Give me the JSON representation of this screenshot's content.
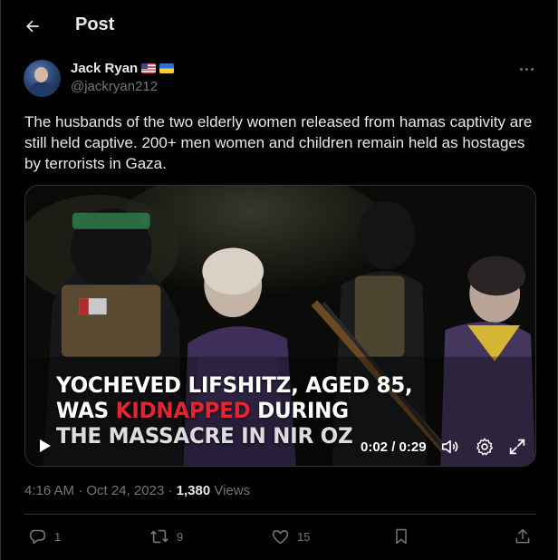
{
  "header": {
    "title": "Post",
    "back_icon": "arrow-left-icon"
  },
  "author": {
    "name": "Jack Ryan",
    "handle": "@jackryan212",
    "badges": [
      "us-flag-icon",
      "ukraine-flag-icon"
    ]
  },
  "tweet": {
    "text": "The husbands of the two elderly women released from hamas captivity are still held captive. 200+ men women and children remain held as hostages by terrorists in Gaza."
  },
  "video": {
    "caption_line1": "YOCHEVED LIFSHITZ, AGED 85,",
    "caption_line2_pre": "WAS ",
    "caption_line2_red": "KIDNAPPED",
    "caption_line2_post": " DURING",
    "caption_line3": "THE MASSACRE IN NIR OZ",
    "time": "0:02 / 0:29",
    "accent_red": "#e3252f"
  },
  "meta": {
    "time": "4:16 AM",
    "separator": "·",
    "date": "Oct 24, 2023",
    "views_count": "1,380",
    "views_label": " Views"
  },
  "actions": {
    "replies": "1",
    "reposts": "9",
    "likes": "15"
  },
  "colors": {
    "background": "#000000",
    "text": "#e7e9ea",
    "secondary": "#71767b",
    "border": "#2f3336"
  }
}
